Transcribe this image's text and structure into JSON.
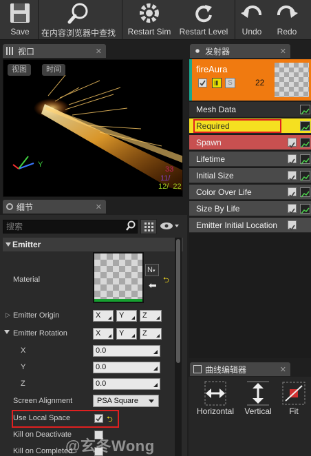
{
  "toolbar": {
    "save": "Save",
    "find_in_browser": "在内容浏览器中查找",
    "restart_sim": "Restart Sim",
    "restart_level": "Restart Level",
    "undo": "Undo",
    "redo": "Redo"
  },
  "viewport": {
    "tab_label": "视口",
    "view_pill": "视图",
    "time_pill": "时间",
    "stat_lines": [
      "33",
      "11/",
      "12/  22"
    ],
    "axis_y": "Y"
  },
  "details": {
    "tab_label": "细节",
    "search_placeholder": "搜索",
    "section": "Emitter",
    "material_label": "Material",
    "emitter_origin": "Emitter Origin",
    "emitter_rotation": "Emitter Rotation",
    "x": "X",
    "y": "Y",
    "z": "Z",
    "rot_x": "0.0",
    "rot_y": "0.0",
    "rot_z": "0.0",
    "screen_alignment": "Screen Alignment",
    "screen_alignment_value": "PSA Square",
    "use_local_space": "Use Local Space",
    "kill_on_deactivate": "Kill on Deactivate",
    "kill_on_completed": "Kill on Completed",
    "mat_button": "N"
  },
  "emitters": {
    "tab_label": "发射器",
    "emitter_name": "fireAura",
    "emitter_count": "22",
    "emitter_icon_s": "S",
    "modules": [
      {
        "label": "Mesh Data"
      },
      {
        "label": "Required"
      },
      {
        "label": "Spawn"
      },
      {
        "label": "Lifetime"
      },
      {
        "label": "Initial Size"
      },
      {
        "label": "Color Over Life"
      },
      {
        "label": "Size By Life"
      },
      {
        "label": "Emitter Initial Location"
      }
    ]
  },
  "curve_editor": {
    "tab_label": "曲线编辑器",
    "horizontal": "Horizontal",
    "vertical": "Vertical",
    "fit": "Fit"
  },
  "watermark": "@玄冬Wong",
  "colors": {
    "accent_orange": "#f07a10",
    "required_yellow": "#f5e020",
    "spawn_red": "#c85050",
    "teal_strip": "#18a890",
    "annotation_red": "#e02020"
  }
}
